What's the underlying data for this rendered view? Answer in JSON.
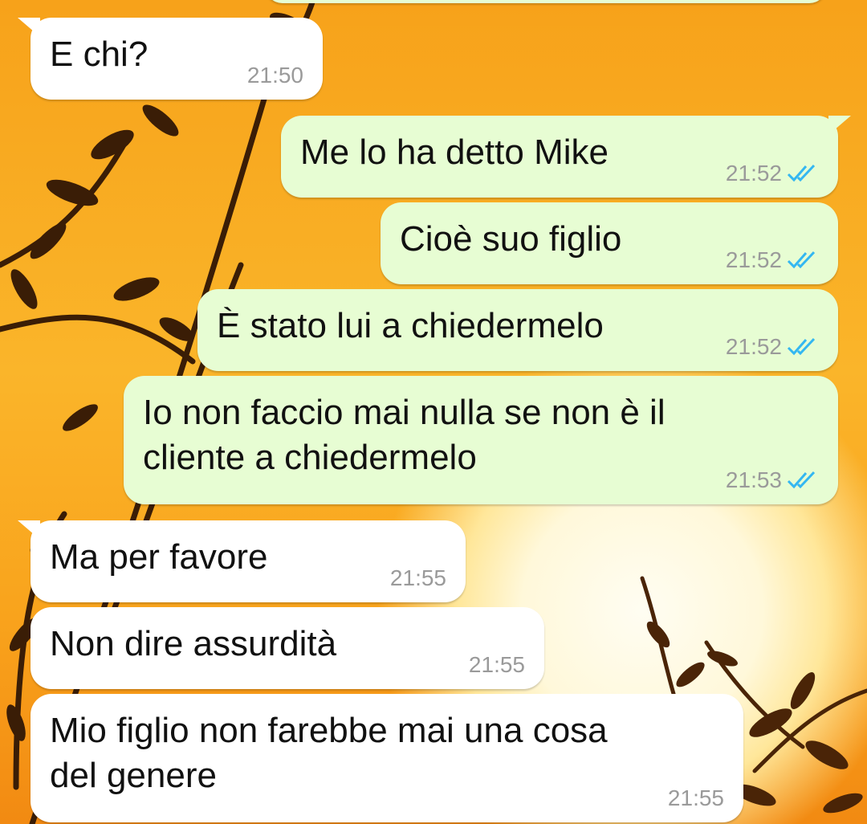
{
  "messages": [
    {
      "text": "E chi?",
      "time": "21:50",
      "direction": "incoming"
    },
    {
      "text": "Me lo ha detto Mike",
      "time": "21:52",
      "direction": "outgoing",
      "status_icon": "double-check-read-icon"
    },
    {
      "text": "Cioè suo figlio",
      "time": "21:52",
      "direction": "outgoing",
      "status_icon": "double-check-read-icon"
    },
    {
      "text": "È stato lui a chiedermelo",
      "time": "21:52",
      "direction": "outgoing",
      "status_icon": "double-check-read-icon"
    },
    {
      "text": "Io non faccio mai nulla se non è il\ncliente a chiedermelo",
      "time": "21:53",
      "direction": "outgoing",
      "status_icon": "double-check-read-icon"
    },
    {
      "text": "Ma per favore",
      "time": "21:55",
      "direction": "incoming"
    },
    {
      "text": "Non dire assurdità",
      "time": "21:55",
      "direction": "incoming"
    },
    {
      "text": "Mio figlio non farebbe mai una cosa\ndel genere",
      "time": "21:55",
      "direction": "incoming"
    }
  ],
  "colors": {
    "incoming_bubble": "#ffffff",
    "outgoing_bubble": "#e7fdd3",
    "read_ticks": "#34b7f1",
    "time_text": "#9a9a9a",
    "wallpaper": "#f9a825"
  }
}
